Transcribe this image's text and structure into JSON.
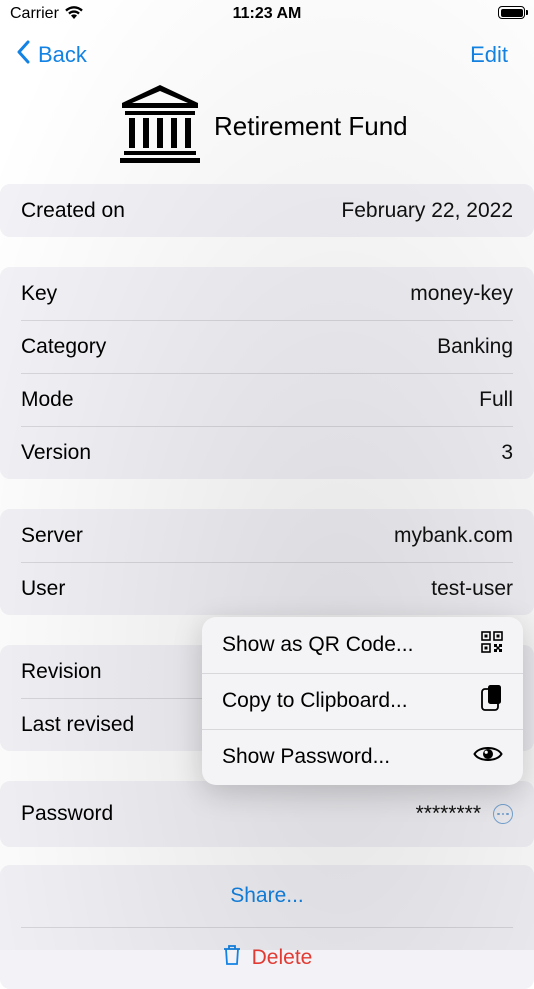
{
  "status": {
    "carrier": "Carrier",
    "time": "11:23 AM"
  },
  "nav": {
    "back_label": "Back",
    "edit_label": "Edit"
  },
  "header": {
    "title": "Retirement Fund",
    "icon": "bank-icon"
  },
  "created": {
    "label": "Created on",
    "value": "February 22, 2022"
  },
  "details": [
    {
      "label": "Key",
      "value": "money-key"
    },
    {
      "label": "Category",
      "value": "Banking"
    },
    {
      "label": "Mode",
      "value": "Full"
    },
    {
      "label": "Version",
      "value": "3"
    }
  ],
  "server": [
    {
      "label": "Server",
      "value": "mybank.com"
    },
    {
      "label": "User",
      "value": "test-user"
    }
  ],
  "revision": [
    {
      "label": "Revision",
      "value": ""
    },
    {
      "label": "Last revised",
      "value": ""
    }
  ],
  "password": {
    "label": "Password",
    "value": "********"
  },
  "actions": {
    "share_label": "Share...",
    "delete_label": "Delete"
  },
  "context_menu": {
    "items": [
      {
        "label": "Show as QR Code...",
        "icon": "qr-code-icon"
      },
      {
        "label": "Copy to Clipboard...",
        "icon": "clipboard-icon"
      },
      {
        "label": "Show Password...",
        "icon": "eye-icon"
      }
    ]
  },
  "colors": {
    "accent": "#1283e4",
    "destructive": "#e23b33",
    "group_bg": "#f2f2f7"
  }
}
